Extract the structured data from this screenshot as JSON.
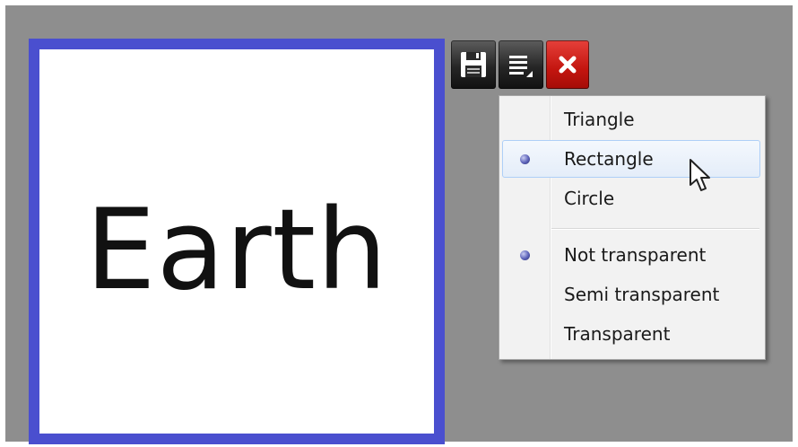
{
  "canvas": {
    "background": "#8e8e8e",
    "shape_border_color": "#4a4fcf",
    "shape_text": "Earth"
  },
  "toolbar": {
    "buttons": [
      {
        "icon": "save-icon"
      },
      {
        "icon": "menu-icon"
      },
      {
        "icon": "close-icon",
        "color": "#c3150f"
      }
    ]
  },
  "menu": {
    "shape_items": [
      {
        "label": "Triangle",
        "selected": false
      },
      {
        "label": "Rectangle",
        "selected": true,
        "hovered": true
      },
      {
        "label": "Circle",
        "selected": false
      }
    ],
    "transparency_items": [
      {
        "label": "Not transparent",
        "selected": true
      },
      {
        "label": "Semi transparent",
        "selected": false
      },
      {
        "label": "Transparent",
        "selected": false
      }
    ]
  }
}
